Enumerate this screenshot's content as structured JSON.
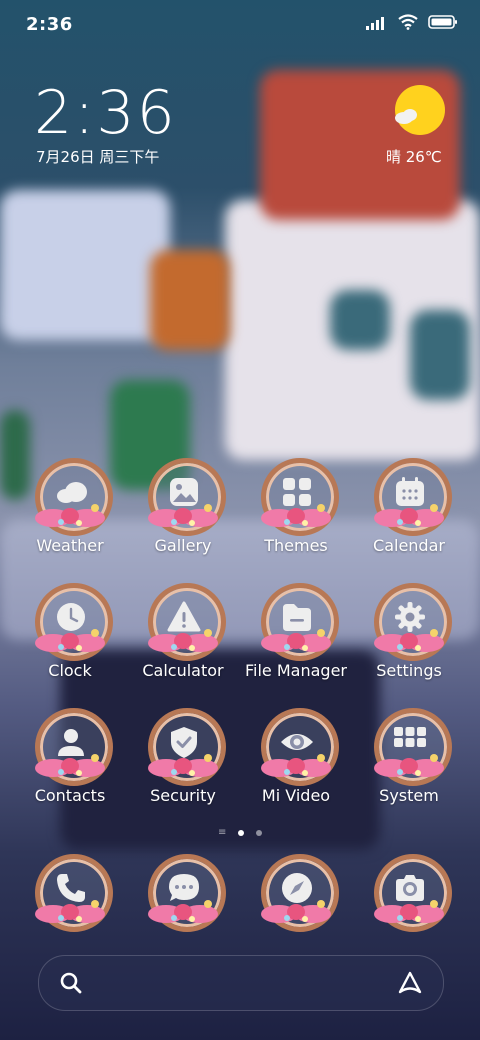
{
  "status": {
    "time": "2:36"
  },
  "clock": {
    "time": "2:36",
    "date": "7月26日 周三下午"
  },
  "weather": {
    "text": "晴 26℃",
    "icon": "sun-cloud-icon"
  },
  "apps": [
    {
      "label": "Weather",
      "icon": "cloud-icon"
    },
    {
      "label": "Gallery",
      "icon": "image-icon"
    },
    {
      "label": "Themes",
      "icon": "grid-icon"
    },
    {
      "label": "Calendar",
      "icon": "calendar-icon"
    },
    {
      "label": "Clock",
      "icon": "clock-icon"
    },
    {
      "label": "Calculator",
      "icon": "warning-icon"
    },
    {
      "label": "File Manager",
      "icon": "folder-icon"
    },
    {
      "label": "Settings",
      "icon": "gear-icon"
    },
    {
      "label": "Contacts",
      "icon": "person-icon"
    },
    {
      "label": "Security",
      "icon": "shield-icon"
    },
    {
      "label": "Mi Video",
      "icon": "eye-icon"
    },
    {
      "label": "System",
      "icon": "folder-grid-icon"
    }
  ],
  "dock": [
    {
      "icon": "phone-icon"
    },
    {
      "icon": "message-icon"
    },
    {
      "icon": "compass-icon"
    },
    {
      "icon": "camera-icon"
    }
  ],
  "pager": {
    "pages": 2,
    "active": 1
  },
  "colors": {
    "accent": "#ffffff",
    "sun": "#ffd21e"
  }
}
